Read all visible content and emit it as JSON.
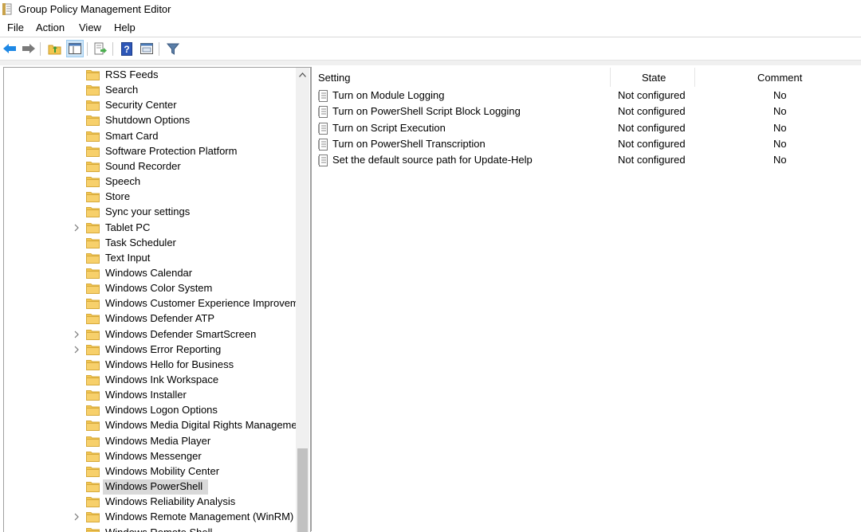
{
  "window": {
    "title": "Group Policy Management Editor"
  },
  "menu": [
    "File",
    "Action",
    "View",
    "Help"
  ],
  "toolbar": {
    "icons": [
      "back-arrow-icon",
      "forward-arrow-icon",
      "up-folder-icon",
      "show-hide-tree-icon",
      "export-list-icon",
      "help-icon",
      "properties-icon",
      "filter-icon"
    ]
  },
  "tree": {
    "items": [
      {
        "label": "RSS Feeds",
        "expandable": false,
        "selected": false
      },
      {
        "label": "Search",
        "expandable": false,
        "selected": false
      },
      {
        "label": "Security Center",
        "expandable": false,
        "selected": false
      },
      {
        "label": "Shutdown Options",
        "expandable": false,
        "selected": false
      },
      {
        "label": "Smart Card",
        "expandable": false,
        "selected": false
      },
      {
        "label": "Software Protection Platform",
        "expandable": false,
        "selected": false
      },
      {
        "label": "Sound Recorder",
        "expandable": false,
        "selected": false
      },
      {
        "label": "Speech",
        "expandable": false,
        "selected": false
      },
      {
        "label": "Store",
        "expandable": false,
        "selected": false
      },
      {
        "label": "Sync your settings",
        "expandable": false,
        "selected": false
      },
      {
        "label": "Tablet PC",
        "expandable": true,
        "selected": false
      },
      {
        "label": "Task Scheduler",
        "expandable": false,
        "selected": false
      },
      {
        "label": "Text Input",
        "expandable": false,
        "selected": false
      },
      {
        "label": "Windows Calendar",
        "expandable": false,
        "selected": false
      },
      {
        "label": "Windows Color System",
        "expandable": false,
        "selected": false
      },
      {
        "label": "Windows Customer Experience Improvem",
        "expandable": false,
        "selected": false
      },
      {
        "label": "Windows Defender ATP",
        "expandable": false,
        "selected": false
      },
      {
        "label": "Windows Defender SmartScreen",
        "expandable": true,
        "selected": false
      },
      {
        "label": "Windows Error Reporting",
        "expandable": true,
        "selected": false
      },
      {
        "label": "Windows Hello for Business",
        "expandable": false,
        "selected": false
      },
      {
        "label": "Windows Ink Workspace",
        "expandable": false,
        "selected": false
      },
      {
        "label": "Windows Installer",
        "expandable": false,
        "selected": false
      },
      {
        "label": "Windows Logon Options",
        "expandable": false,
        "selected": false
      },
      {
        "label": "Windows Media Digital Rights Manageme",
        "expandable": false,
        "selected": false
      },
      {
        "label": "Windows Media Player",
        "expandable": false,
        "selected": false
      },
      {
        "label": "Windows Messenger",
        "expandable": false,
        "selected": false
      },
      {
        "label": "Windows Mobility Center",
        "expandable": false,
        "selected": false
      },
      {
        "label": "Windows PowerShell",
        "expandable": false,
        "selected": true
      },
      {
        "label": "Windows Reliability Analysis",
        "expandable": false,
        "selected": false
      },
      {
        "label": "Windows Remote Management (WinRM)",
        "expandable": true,
        "selected": false
      },
      {
        "label": "Windows Remote Shell",
        "expandable": false,
        "selected": false
      }
    ]
  },
  "list": {
    "columns": {
      "setting": "Setting",
      "state": "State",
      "comment": "Comment"
    },
    "rows": [
      {
        "setting": "Turn on Module Logging",
        "state": "Not configured",
        "comment": "No"
      },
      {
        "setting": "Turn on PowerShell Script Block Logging",
        "state": "Not configured",
        "comment": "No"
      },
      {
        "setting": "Turn on Script Execution",
        "state": "Not configured",
        "comment": "No"
      },
      {
        "setting": "Turn on PowerShell Transcription",
        "state": "Not configured",
        "comment": "No"
      },
      {
        "setting": "Set the default source path for Update-Help",
        "state": "Not configured",
        "comment": "No"
      }
    ]
  },
  "colors": {
    "selection": "#d9d9d9",
    "folder": "#f3c650",
    "accent_blue": "#1e88e5"
  }
}
